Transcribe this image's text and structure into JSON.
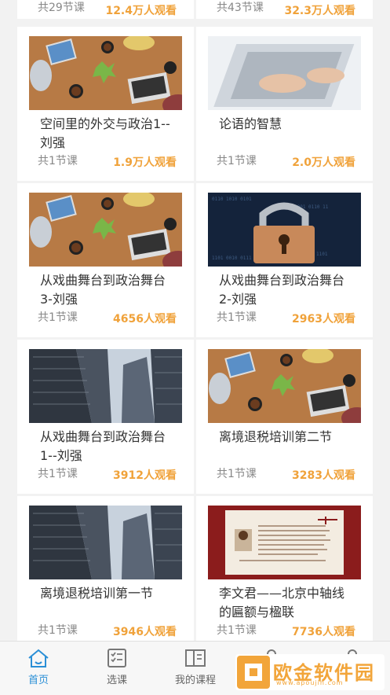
{
  "top_cards": [
    {
      "count": "共29节课",
      "views": "12.4万人观看"
    },
    {
      "count": "共43节课",
      "views": "32.3万人观看"
    }
  ],
  "cards": [
    {
      "title": "空间里的外交与政治1--刘强",
      "count": "共1节课",
      "views": "1.9万人观看",
      "thumb": "office-desk"
    },
    {
      "title": "论语的智慧",
      "count": "共1节课",
      "views": "2.0万人观看",
      "thumb": "laptop-typing"
    },
    {
      "title": "从戏曲舞台到政治舞台3-刘强",
      "count": "共1节课",
      "views": "4656人观看",
      "thumb": "office-desk"
    },
    {
      "title": "从戏曲舞台到政治舞台2-刘强",
      "count": "共1节课",
      "views": "2963人观看",
      "thumb": "padlock"
    },
    {
      "title": "从戏曲舞台到政治舞台1--刘强",
      "count": "共1节课",
      "views": "3912人观看",
      "thumb": "skyscrapers"
    },
    {
      "title": "离境退税培训第二节",
      "count": "共1节课",
      "views": "3283人观看",
      "thumb": "office-desk"
    },
    {
      "title": "离境退税培训第一节",
      "count": "共1节课",
      "views": "3946人观看",
      "thumb": "skyscrapers"
    },
    {
      "title": "李文君——北京中轴线的匾额与楹联",
      "count": "共1节课",
      "views": "7736人观看",
      "thumb": "document"
    }
  ],
  "tabs": [
    {
      "label": "首页",
      "icon": "home-icon"
    },
    {
      "label": "选课",
      "icon": "checklist-icon"
    },
    {
      "label": "我的课程",
      "icon": "book-icon"
    },
    {
      "label": "",
      "icon": "group-icon"
    },
    {
      "label": "",
      "icon": "user-icon"
    }
  ],
  "watermark": {
    "text": "欧金软件园",
    "url": "www.apoujin.com"
  },
  "colors": {
    "accent": "#2a8fd6",
    "views": "#f0a23a"
  }
}
